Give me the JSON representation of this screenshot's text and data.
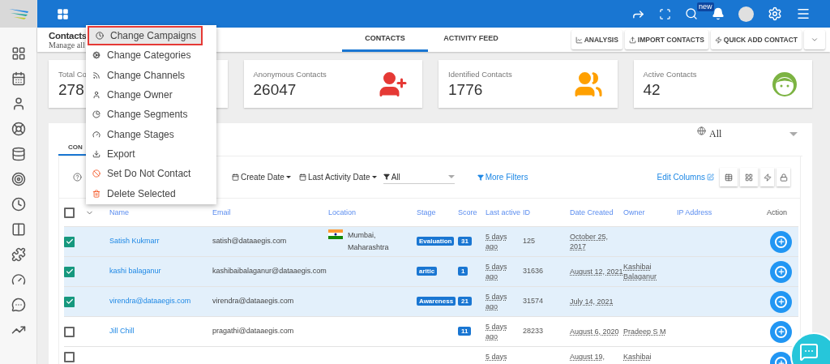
{
  "topbar": {
    "badge": "new"
  },
  "page": {
    "title": "Contacts",
    "subtitle": "Manage all"
  },
  "tabs": [
    {
      "label": "CONTACTS",
      "selected": true
    },
    {
      "label": "ACTIVITY FEED",
      "selected": false
    }
  ],
  "actions": [
    "ANALYSIS",
    "IMPORT CONTACTS",
    "QUICK ADD CONTACT"
  ],
  "stats": [
    {
      "label": "Total Co",
      "value": "278"
    },
    {
      "label": "Anonymous Contacts",
      "value": "26047"
    },
    {
      "label": "Identified Contacts",
      "value": "1776"
    },
    {
      "label": "Active Contacts",
      "value": "42"
    }
  ],
  "list": {
    "region": "All",
    "tabs": [
      {
        "label": "CON",
        "selected": true
      }
    ],
    "filters": {
      "create_date": "Create Date",
      "last_activity": "Last Activity Date",
      "segment": "All",
      "more": "More Filters",
      "edit": "Edit Columns"
    }
  },
  "table": {
    "select_all_checked": false,
    "columns": [
      "Name",
      "Email",
      "Location",
      "Stage",
      "Score",
      "Last active",
      "ID",
      "Date Created",
      "Owner",
      "IP Address",
      "Action"
    ],
    "rows": [
      {
        "checked": true,
        "name": "Satish Kukmarr",
        "email": "satish@dataaegis.com",
        "location": "Mumbai, Maharashtra",
        "stage": "Evaluation",
        "score": "31",
        "last_active": "5 days ago",
        "id": "125",
        "date_created": "October 25, 2017",
        "owner": ""
      },
      {
        "checked": true,
        "name": "kashi balaganur",
        "email": "kashibaibalaganur@dataaegis.com",
        "location": "",
        "stage": "aritic",
        "score": "1",
        "last_active": "5 days ago",
        "id": "31636",
        "date_created": "August 12, 2021",
        "owner": "Kashibai Balaganur"
      },
      {
        "checked": true,
        "name": "virendra@dataaegis.com",
        "email": "virendra@dataaegis.com",
        "location": "",
        "stage": "Awareness",
        "score": "21",
        "last_active": "5 days ago",
        "id": "31574",
        "date_created": "July 14, 2021",
        "owner": ""
      },
      {
        "checked": false,
        "name": "Jill Chill",
        "email": "pragathi@dataaegis.com",
        "location": "",
        "stage": "",
        "score": "11",
        "last_active": "5 days ago",
        "id": "28233",
        "date_created": "August 6, 2020",
        "owner": "Pradeep S M"
      },
      {
        "checked": false,
        "name": "",
        "email": "",
        "location": "",
        "stage": "",
        "score": "",
        "last_active": "5 days",
        "id": "",
        "date_created": "August 19,",
        "owner": "Kashibai"
      }
    ]
  },
  "menu": {
    "items": [
      {
        "label": "Change Campaigns",
        "selected": true
      },
      {
        "label": "Change Categories",
        "selected": false
      },
      {
        "label": "Change Channels",
        "selected": false
      },
      {
        "label": "Change Owner",
        "selected": false
      },
      {
        "label": "Change Segments",
        "selected": false
      },
      {
        "label": "Change Stages",
        "selected": false
      },
      {
        "label": "Export",
        "selected": false
      },
      {
        "label": "Set Do Not Contact",
        "selected": false
      },
      {
        "label": "Delete Selected",
        "selected": false
      }
    ]
  }
}
